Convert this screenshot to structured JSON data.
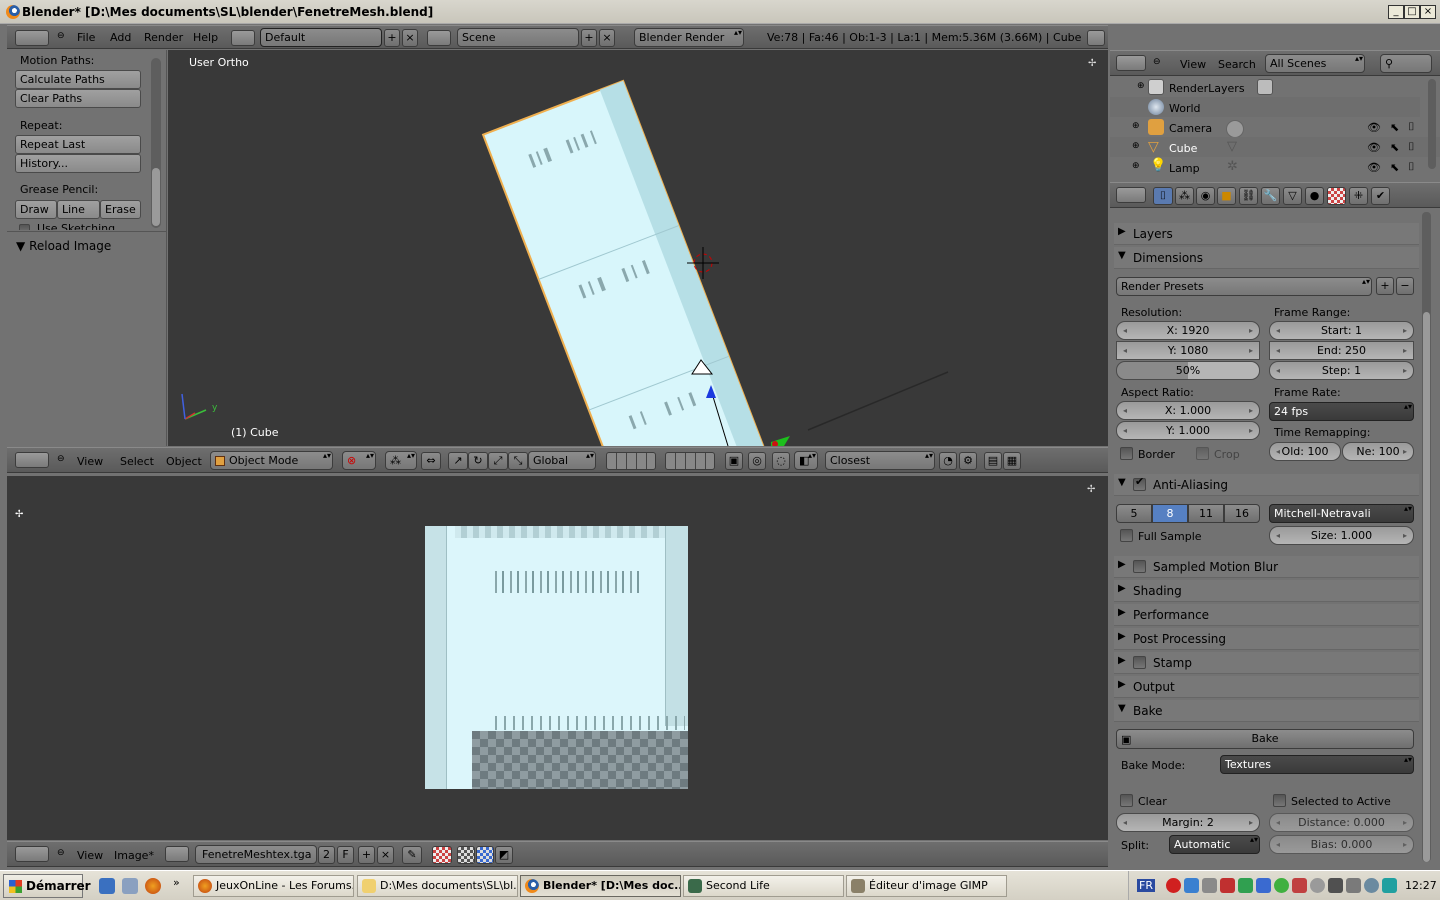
{
  "window": {
    "title": "Blender* [D:\\Mes documents\\SL\\blender\\FenetreMesh.blend]",
    "buttons": [
      "_",
      "□",
      "×"
    ]
  },
  "info_header": {
    "menus": [
      "File",
      "Add",
      "Render",
      "Help"
    ],
    "layout": "Default",
    "scene": "Scene",
    "engine": "Blender Render",
    "stats": "Ve:78 | Fa:46 | Ob:1-3 | La:1 | Mem:5.36M (3.66M) | Cube"
  },
  "tool_shelf": {
    "motion_paths_label": "Motion Paths:",
    "calculate_paths": "Calculate Paths",
    "clear_paths": "Clear Paths",
    "repeat_label": "Repeat:",
    "repeat_last": "Repeat Last",
    "history": "History...",
    "grease_pencil_label": "Grease Pencil:",
    "draw": "Draw",
    "line": "Line",
    "erase": "Erase",
    "use_sketching": "Use Sketching Sessio",
    "reload_image": "Reload Image"
  },
  "viewport": {
    "view_name": "User Ortho",
    "object_label": "(1) Cube",
    "axis_y": "y"
  },
  "view3d_header": {
    "menus": [
      "View",
      "Select",
      "Object"
    ],
    "mode": "Object Mode",
    "orientation": "Global",
    "snap": "Closest"
  },
  "image_header": {
    "menus": [
      "View",
      "Image*"
    ],
    "image_name": "FenetreMeshtex.tga",
    "users": "2",
    "fake": "F"
  },
  "outliner": {
    "menus": [
      "View",
      "Search"
    ],
    "filter": "All Scenes",
    "items": [
      {
        "label": "RenderLayers",
        "selected": false
      },
      {
        "label": "World",
        "selected": false
      },
      {
        "label": "Camera",
        "selected": false
      },
      {
        "label": "Cube",
        "selected": true
      },
      {
        "label": "Lamp",
        "selected": false
      }
    ]
  },
  "properties": {
    "layers": "Layers",
    "dimensions": "Dimensions",
    "render_presets": "Render Presets",
    "resolution_label": "Resolution:",
    "res_x": "X: 1920",
    "res_y": "Y: 1080",
    "res_pct": "50%",
    "frame_range_label": "Frame Range:",
    "start": "Start: 1",
    "end": "End: 250",
    "step": "Step: 1",
    "aspect_label": "Aspect Ratio:",
    "aspect_x": "X: 1.000",
    "aspect_y": "Y: 1.000",
    "frame_rate_label": "Frame Rate:",
    "fps": "24 fps",
    "time_remap_label": "Time Remapping:",
    "border": "Border",
    "crop": "Crop",
    "old": "Old: 100",
    "new": "Ne: 100",
    "anti_aliasing": "Anti-Aliasing",
    "aa_samples": [
      "5",
      "8",
      "11",
      "16"
    ],
    "aa_filter": "Mitchell-Netravali",
    "full_sample": "Full Sample",
    "aa_size": "Size: 1.000",
    "sampled_motion_blur": "Sampled Motion Blur",
    "shading": "Shading",
    "performance": "Performance",
    "post_processing": "Post Processing",
    "stamp": "Stamp",
    "output": "Output",
    "bake": "Bake",
    "bake_button": "Bake",
    "bake_mode_label": "Bake Mode:",
    "bake_mode": "Textures",
    "clear": "Clear",
    "selected_to_active": "Selected to Active",
    "margin": "Margin: 2",
    "distance": "Distance: 0.000",
    "split_label": "Split:",
    "split": "Automatic",
    "bias": "Bias: 0.000"
  },
  "taskbar": {
    "start": "Démarrer",
    "items": [
      "JeuxOnLine - Les Forums...",
      "D:\\Mes documents\\SL\\bl...",
      "Blender* [D:\\Mes doc...",
      "Second Life",
      "Éditeur d'image GIMP"
    ],
    "lang": "FR",
    "clock": "12:27"
  }
}
